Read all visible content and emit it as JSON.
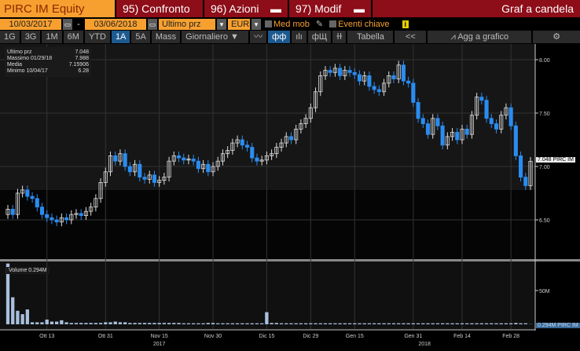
{
  "header": {
    "ticker": "PIRC IM Equity",
    "btn1": "95) Confronto",
    "btn2": "96) Azioni",
    "btn3": "97) Modif",
    "title": "Graf a candela"
  },
  "controls": {
    "start_date": "10/03/2017",
    "end_date": "03/06/2018",
    "field": "Ultimo prz",
    "currency": "EUR",
    "med_mob": "Med mob",
    "eventi": "Eventi chiave",
    "info": "i",
    "dash": "-"
  },
  "toolbar": {
    "periods": [
      "1G",
      "3G",
      "1M",
      "6M",
      "YTD",
      "1A",
      "5A",
      "Mass"
    ],
    "active": "1A",
    "freq": "Giornaliero ▼",
    "tabella": "Tabella",
    "collapse": "<<",
    "add": "Agg a grafico",
    "settings": "⚙"
  },
  "legend": {
    "last_label": "Ultimo prz",
    "last": "7.048",
    "max_label": "Massimo 01/29/18",
    "max": "7.988",
    "avg_label": "Media",
    "avg": "7.15906",
    "min_label": "Minimo 10/04/17",
    "min": "6.28"
  },
  "volume_legend": "Volume 0.294M",
  "price_tag": "7.048 PIRC IM",
  "volume_tag": "0.294M PIRC IM",
  "colors": {
    "down": "#2a8cf0",
    "up": "#ffffff",
    "accent": "#f7a030",
    "header_red": "#8d0d18"
  },
  "chart_data": {
    "type": "candlestick",
    "title": "Graf a candela",
    "y_ticks": [
      "8.00",
      "7.50",
      "7.00",
      "6.50"
    ],
    "ylim": [
      6.2,
      8.05
    ],
    "vol_ticks": [
      "50M"
    ],
    "x_ticks": [
      {
        "label": "Ott 13",
        "i": 8
      },
      {
        "label": "Ott 31",
        "i": 20
      },
      {
        "label": "Nov 15",
        "i": 31,
        "sub": "2017"
      },
      {
        "label": "Nov 30",
        "i": 42
      },
      {
        "label": "Dic 15",
        "i": 53
      },
      {
        "label": "Dic 29",
        "i": 62
      },
      {
        "label": "Gen 15",
        "i": 71
      },
      {
        "label": "Gen 31",
        "i": 83
      },
      {
        "label": "Feb 14",
        "i": 93
      },
      {
        "label": "Feb 28",
        "i": 103,
        "sub2": "2018"
      }
    ],
    "close": [
      6.6,
      6.55,
      6.75,
      6.78,
      6.72,
      6.7,
      6.62,
      6.55,
      6.52,
      6.5,
      6.48,
      6.52,
      6.5,
      6.55,
      6.56,
      6.54,
      6.58,
      6.62,
      6.7,
      6.85,
      6.95,
      7.1,
      7.05,
      7.12,
      7.0,
      6.95,
      7.02,
      6.9,
      6.88,
      6.92,
      6.85,
      6.87,
      6.9,
      7.05,
      7.1,
      7.08,
      7.06,
      7.07,
      7.05,
      6.98,
      7.02,
      6.95,
      7.0,
      7.05,
      7.12,
      7.15,
      7.22,
      7.25,
      7.2,
      7.18,
      7.08,
      7.05,
      7.06,
      7.1,
      7.12,
      7.18,
      7.22,
      7.28,
      7.25,
      7.35,
      7.4,
      7.45,
      7.55,
      7.7,
      7.85,
      7.9,
      7.88,
      7.92,
      7.85,
      7.9,
      7.88,
      7.86,
      7.8,
      7.85,
      7.75,
      7.72,
      7.7,
      7.78,
      7.85,
      7.82,
      7.95,
      7.8,
      7.78,
      7.6,
      7.45,
      7.4,
      7.3,
      7.45,
      7.38,
      7.2,
      7.28,
      7.32,
      7.25,
      7.35,
      7.3,
      7.48,
      7.65,
      7.62,
      7.45,
      7.4,
      7.35,
      7.48,
      7.55,
      7.38,
      7.1,
      6.9,
      6.82,
      7.048
    ],
    "volume_m": [
      90,
      40,
      20,
      15,
      22,
      3,
      3,
      3,
      7,
      4,
      4,
      6,
      3,
      2,
      2,
      2,
      2,
      2,
      2,
      2,
      3,
      3,
      4,
      3,
      3,
      2,
      2,
      2,
      2,
      2,
      2,
      2,
      2,
      2,
      2,
      2,
      1.5,
      1.5,
      1.5,
      1.5,
      1.5,
      2,
      2,
      1.5,
      1.5,
      1.5,
      1.5,
      1.5,
      1.5,
      1.5,
      1.5,
      1.5,
      1.5,
      18,
      2,
      2,
      1.5,
      1.5,
      1.5,
      1.5,
      1.5,
      1.5,
      1.5,
      1.5,
      1.5,
      1.5,
      1.5,
      1.5,
      1.5,
      1.5,
      1.5,
      1.5,
      1.5,
      1.5,
      1.5,
      1.5,
      1.5,
      1.5,
      1.5,
      1.5,
      1.5,
      1.5,
      1.5,
      1.5,
      1.5,
      1.5,
      1.5,
      1.5,
      1.5,
      1.5,
      1.5,
      1.5,
      1.5,
      1.5,
      1.5,
      1.5,
      1.5,
      1.5,
      1.5,
      1.5,
      1.5,
      1.5,
      1.5,
      1.5,
      2,
      1.5,
      1.5,
      0.294
    ]
  }
}
